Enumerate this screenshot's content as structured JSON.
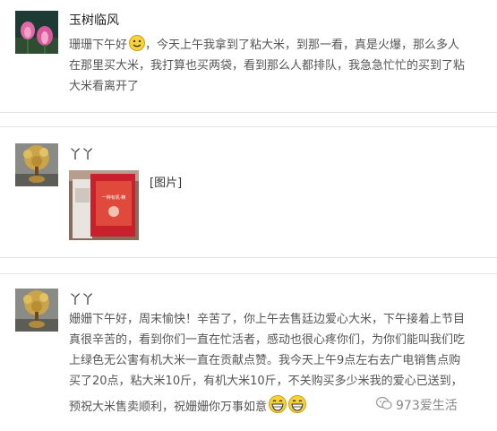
{
  "posts": [
    {
      "author": "玉树临风",
      "lines": [
        "珊珊下午好",
        "，今天上午我拿到了粘大米，到那一看，真是火爆，那么多人",
        "在那里买大米，我打算也买两袋，看到那么人都排队，我急急忙忙的买到了粘",
        "大米看离开了"
      ]
    },
    {
      "author": "丫丫",
      "image_label": "[图片]",
      "package_text": "一种有机·精"
    },
    {
      "author": "丫丫",
      "lines": [
        "姗姗下午好，周末愉快！辛苦了，你上午去售廷边爱心大米，下午接着上节目",
        "真很辛苦的，看到你们一直在忙活者，感动也很心疼你们，为你们能叫我们吃",
        "上绿色无公害有机大米一直在贡献点赞。我今天上午9点左右去广电销售点购",
        "买了20点，粘大米10斤，有机大米10斤，不关购买多少米我的爱心已送到，",
        "预祝大米售卖顺利，祝姗姗你万事如意"
      ]
    }
  ],
  "watermark": "973爱生活",
  "colors": {
    "divider": "#e4e4e4",
    "text": "#555555",
    "name": "#222222",
    "bag_red": "#c8202c"
  }
}
